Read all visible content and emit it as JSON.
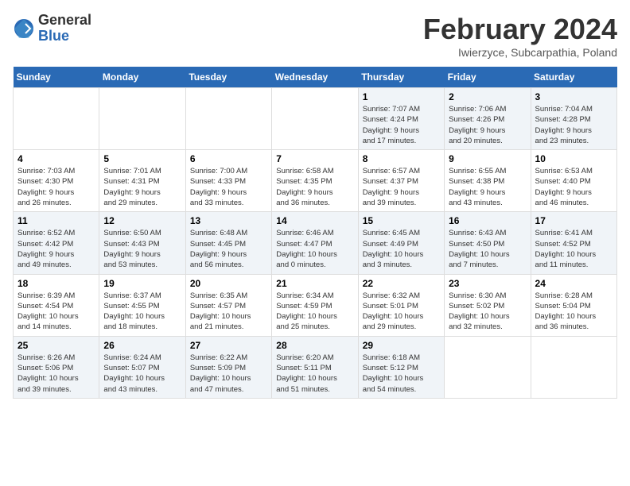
{
  "logo": {
    "general": "General",
    "blue": "Blue"
  },
  "title": "February 2024",
  "location": "Iwierzyce, Subcarpathia, Poland",
  "days_of_week": [
    "Sunday",
    "Monday",
    "Tuesday",
    "Wednesday",
    "Thursday",
    "Friday",
    "Saturday"
  ],
  "weeks": [
    [
      {
        "day": "",
        "info": ""
      },
      {
        "day": "",
        "info": ""
      },
      {
        "day": "",
        "info": ""
      },
      {
        "day": "",
        "info": ""
      },
      {
        "day": "1",
        "info": "Sunrise: 7:07 AM\nSunset: 4:24 PM\nDaylight: 9 hours\nand 17 minutes."
      },
      {
        "day": "2",
        "info": "Sunrise: 7:06 AM\nSunset: 4:26 PM\nDaylight: 9 hours\nand 20 minutes."
      },
      {
        "day": "3",
        "info": "Sunrise: 7:04 AM\nSunset: 4:28 PM\nDaylight: 9 hours\nand 23 minutes."
      }
    ],
    [
      {
        "day": "4",
        "info": "Sunrise: 7:03 AM\nSunset: 4:30 PM\nDaylight: 9 hours\nand 26 minutes."
      },
      {
        "day": "5",
        "info": "Sunrise: 7:01 AM\nSunset: 4:31 PM\nDaylight: 9 hours\nand 29 minutes."
      },
      {
        "day": "6",
        "info": "Sunrise: 7:00 AM\nSunset: 4:33 PM\nDaylight: 9 hours\nand 33 minutes."
      },
      {
        "day": "7",
        "info": "Sunrise: 6:58 AM\nSunset: 4:35 PM\nDaylight: 9 hours\nand 36 minutes."
      },
      {
        "day": "8",
        "info": "Sunrise: 6:57 AM\nSunset: 4:37 PM\nDaylight: 9 hours\nand 39 minutes."
      },
      {
        "day": "9",
        "info": "Sunrise: 6:55 AM\nSunset: 4:38 PM\nDaylight: 9 hours\nand 43 minutes."
      },
      {
        "day": "10",
        "info": "Sunrise: 6:53 AM\nSunset: 4:40 PM\nDaylight: 9 hours\nand 46 minutes."
      }
    ],
    [
      {
        "day": "11",
        "info": "Sunrise: 6:52 AM\nSunset: 4:42 PM\nDaylight: 9 hours\nand 49 minutes."
      },
      {
        "day": "12",
        "info": "Sunrise: 6:50 AM\nSunset: 4:43 PM\nDaylight: 9 hours\nand 53 minutes."
      },
      {
        "day": "13",
        "info": "Sunrise: 6:48 AM\nSunset: 4:45 PM\nDaylight: 9 hours\nand 56 minutes."
      },
      {
        "day": "14",
        "info": "Sunrise: 6:46 AM\nSunset: 4:47 PM\nDaylight: 10 hours\nand 0 minutes."
      },
      {
        "day": "15",
        "info": "Sunrise: 6:45 AM\nSunset: 4:49 PM\nDaylight: 10 hours\nand 3 minutes."
      },
      {
        "day": "16",
        "info": "Sunrise: 6:43 AM\nSunset: 4:50 PM\nDaylight: 10 hours\nand 7 minutes."
      },
      {
        "day": "17",
        "info": "Sunrise: 6:41 AM\nSunset: 4:52 PM\nDaylight: 10 hours\nand 11 minutes."
      }
    ],
    [
      {
        "day": "18",
        "info": "Sunrise: 6:39 AM\nSunset: 4:54 PM\nDaylight: 10 hours\nand 14 minutes."
      },
      {
        "day": "19",
        "info": "Sunrise: 6:37 AM\nSunset: 4:55 PM\nDaylight: 10 hours\nand 18 minutes."
      },
      {
        "day": "20",
        "info": "Sunrise: 6:35 AM\nSunset: 4:57 PM\nDaylight: 10 hours\nand 21 minutes."
      },
      {
        "day": "21",
        "info": "Sunrise: 6:34 AM\nSunset: 4:59 PM\nDaylight: 10 hours\nand 25 minutes."
      },
      {
        "day": "22",
        "info": "Sunrise: 6:32 AM\nSunset: 5:01 PM\nDaylight: 10 hours\nand 29 minutes."
      },
      {
        "day": "23",
        "info": "Sunrise: 6:30 AM\nSunset: 5:02 PM\nDaylight: 10 hours\nand 32 minutes."
      },
      {
        "day": "24",
        "info": "Sunrise: 6:28 AM\nSunset: 5:04 PM\nDaylight: 10 hours\nand 36 minutes."
      }
    ],
    [
      {
        "day": "25",
        "info": "Sunrise: 6:26 AM\nSunset: 5:06 PM\nDaylight: 10 hours\nand 39 minutes."
      },
      {
        "day": "26",
        "info": "Sunrise: 6:24 AM\nSunset: 5:07 PM\nDaylight: 10 hours\nand 43 minutes."
      },
      {
        "day": "27",
        "info": "Sunrise: 6:22 AM\nSunset: 5:09 PM\nDaylight: 10 hours\nand 47 minutes."
      },
      {
        "day": "28",
        "info": "Sunrise: 6:20 AM\nSunset: 5:11 PM\nDaylight: 10 hours\nand 51 minutes."
      },
      {
        "day": "29",
        "info": "Sunrise: 6:18 AM\nSunset: 5:12 PM\nDaylight: 10 hours\nand 54 minutes."
      },
      {
        "day": "",
        "info": ""
      },
      {
        "day": "",
        "info": ""
      }
    ]
  ]
}
